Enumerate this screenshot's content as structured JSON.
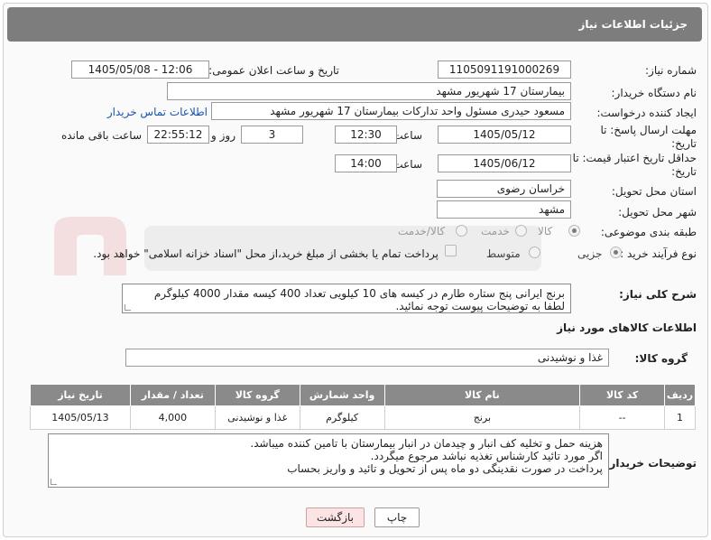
{
  "window": {
    "title": "جزئیات اطلاعات نیاز"
  },
  "form": {
    "need_number": {
      "label": "شماره نیاز:",
      "value": "1105091191000269"
    },
    "announce_datetime": {
      "label": "تاریخ و ساعت اعلان عمومی:",
      "value": "1405/05/08 - 12:06"
    },
    "buyer_org": {
      "label": "نام دستگاه خریدار:",
      "value": "بیمارستان 17 شهریور مشهد"
    },
    "requester": {
      "label": "ایجاد کننده درخواست:",
      "value": "مسعود حیدری مسئول واحد تدارکات  بیمارستان 17 شهریور مشهد",
      "contact_link": "اطلاعات تماس خریدار"
    },
    "reply_deadline": {
      "label": "مهلت ارسال پاسخ: تا تاریخ:",
      "date": "1405/05/12",
      "time_label": "ساعت",
      "time": "12:30",
      "days": "3",
      "days_label": "روز و",
      "remaining": "22:55:12",
      "remaining_label": "ساعت باقی مانده"
    },
    "price_validity": {
      "label": "حداقل تاریخ اعتبار قیمت: تا تاریخ:",
      "date": "1405/06/12",
      "time_label": "ساعت",
      "time": "14:00"
    },
    "province": {
      "label": "استان محل تحویل:",
      "value": "خراسان رضوی"
    },
    "city": {
      "label": "شهر محل تحویل:",
      "value": "مشهد"
    },
    "category": {
      "label": "طبقه بندی موضوعی:",
      "options": [
        "کالا",
        "خدمت",
        "کالا/خدمت"
      ],
      "selected": "کالا"
    },
    "process_type": {
      "label": "نوع فرآیند خرید :",
      "options": [
        "جزیی",
        "متوسط"
      ],
      "selected": "جزیی",
      "payment_note": "پرداخت تمام یا بخشی از مبلغ خرید،از محل \"اسناد خزانه اسلامی\" خواهد بود."
    },
    "description": {
      "label": "شرح کلی نیاز:",
      "lines": [
        "برنج ایرانی پنج ستاره طارم در کیسه های 10 کیلویی تعداد 400 کیسه مقدار 4000 کیلوگرم",
        "لطفا به توضیحات پیوست توجه نمائید."
      ]
    },
    "goods_info_title": "اطلاعات کالاهای مورد نیاز",
    "goods_group": {
      "label": "گروه کالا:",
      "value": "غذا و نوشیدنی"
    }
  },
  "table": {
    "headers": [
      "ردیف",
      "کد کالا",
      "نام کالا",
      "واحد شمارش",
      "گروه کالا",
      "تعداد / مقدار",
      "تاریخ نیاز"
    ],
    "rows": [
      [
        "1",
        "--",
        "برنج",
        "کیلوگرم",
        "غذا و نوشیدنی",
        "4,000",
        "1405/05/13"
      ]
    ]
  },
  "buyer_notes": {
    "label": "توضیحات خریدار:",
    "lines": [
      "هزینه حمل و تخلیه کف انبار و چیدمان در انبار بیمارستان با تامین کننده میباشد.",
      "اگر مورد تائید کارشناس تغذیه نباشد مرجوع میگردد.",
      "پرداخت در صورت نقدینگی دو ماه پس از تحویل و تائید و واریز بحساب"
    ]
  },
  "buttons": {
    "print": "چاپ",
    "back": "بازگشت"
  },
  "colors": {
    "title_bar": "#7d7d7d",
    "table_header": "#8a8a8a",
    "link": "#1a54a6",
    "back_button": "#fde4e4"
  }
}
